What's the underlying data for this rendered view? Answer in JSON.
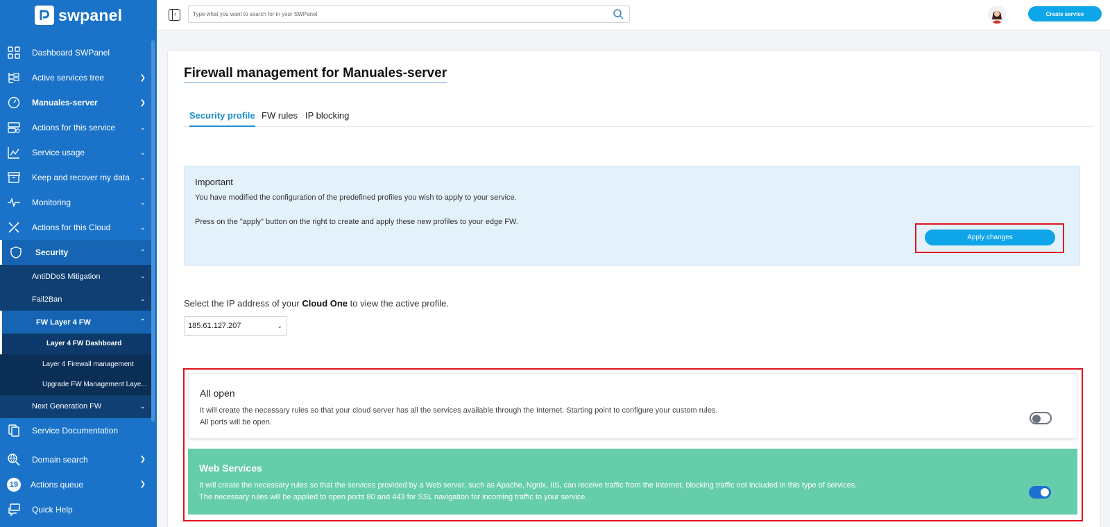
{
  "app": {
    "name": "swpanel"
  },
  "sidebar": {
    "items": [
      {
        "label": "Dashboard SWPanel"
      },
      {
        "label": "Active services tree"
      },
      {
        "label": "Manuales-server"
      },
      {
        "label": "Actions for this service"
      },
      {
        "label": "Service usage"
      },
      {
        "label": "Keep and recover my data"
      },
      {
        "label": "Monitoring"
      },
      {
        "label": "Actions for this Cloud"
      },
      {
        "label": "Security"
      },
      {
        "label": "AntiDDoS Mitigation"
      },
      {
        "label": "Fail2Ban"
      },
      {
        "label": "FW Layer 4 FW"
      },
      {
        "label": "Layer 4 FW Dashboard"
      },
      {
        "label": "Layer 4 Firewall management"
      },
      {
        "label": "Upgrade FW Management Laye..."
      },
      {
        "label": "Next Generation FW"
      },
      {
        "label": "Service Documentation"
      },
      {
        "label": "Domain search"
      },
      {
        "label": "Actions queue",
        "badge": "19"
      },
      {
        "label": "Quick Help"
      }
    ]
  },
  "topbar": {
    "search_placeholder": "Type what you want to search for in your SWPanel",
    "create_label": "Create service"
  },
  "main": {
    "title": "Firewall management for Manuales-server",
    "tabs": [
      {
        "label": "Security profile"
      },
      {
        "label": "FW rules"
      },
      {
        "label": "IP blocking"
      }
    ],
    "alert": {
      "title": "Important",
      "line1": "You have modified the configuration of the predefined profiles you wish to apply to your service.",
      "line2": "Press on the \"apply\" button on the right to create and apply these new profiles to your edge FW.",
      "button": "Apply changes"
    },
    "ip_select": {
      "prefix": "Select the IP address of your ",
      "bold": "Cloud One",
      "suffix": " to view the active profile.",
      "value": "185.61.127.207"
    },
    "profiles": [
      {
        "title": "All open",
        "line1": "It will create the necessary rules so that your cloud server has all the services available through the Internet. Starting point to configure your custom rules.",
        "line2": "All ports will be open.",
        "enabled": false
      },
      {
        "title": "Web Services",
        "line1": "It will create the necessary rules so that the services provided by a Web server, such as Apache, Ngnix, IIS, can receive traffic from the Internet, blocking traffic not included in this type of services.",
        "line2": "The necessary rules will be applied to open ports 80 and 443 for SSL navigation for incoming traffic to your service.",
        "enabled": true
      }
    ]
  },
  "colors": {
    "brand": "#1a73c9",
    "accent": "#0ea5e9",
    "highlight": "#e0141e",
    "profile_active": "#66cdaa"
  }
}
